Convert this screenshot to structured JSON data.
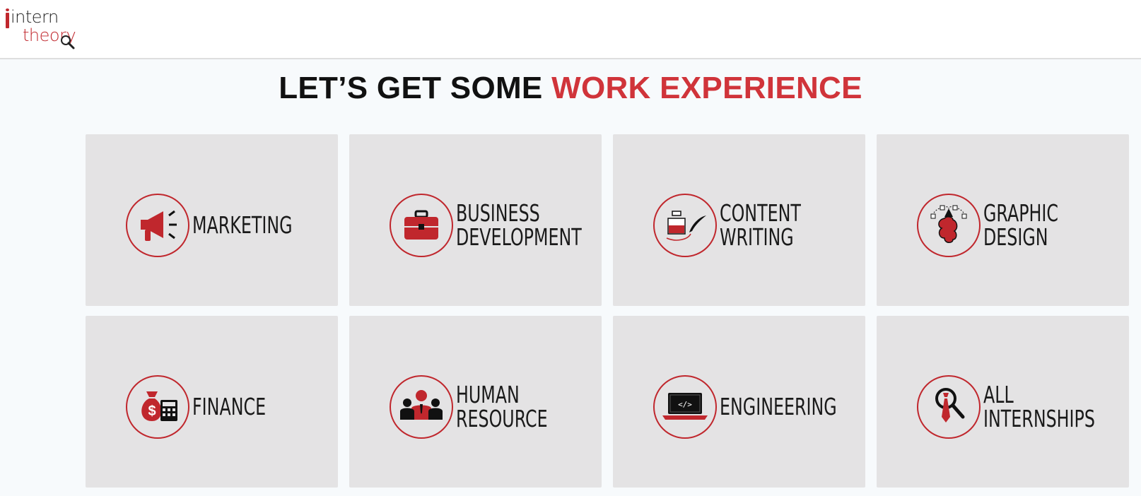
{
  "brand": {
    "line1": "intern",
    "line2": "theory",
    "colors": {
      "red": "#c0272d",
      "dark": "#222222"
    }
  },
  "headline": {
    "black": "LET’S GET SOME",
    "red": "WORK EXPERIENCE"
  },
  "categories": [
    {
      "label_line1": "MARKETING",
      "label_line2": "",
      "icon": "megaphone-icon"
    },
    {
      "label_line1": "BUSINESS",
      "label_line2": "DEVELOPMENT",
      "icon": "briefcase-icon"
    },
    {
      "label_line1": "CONTENT",
      "label_line2": "WRITING",
      "icon": "inkpot-quill-icon"
    },
    {
      "label_line1": "GRAPHIC",
      "label_line2": "DESIGN",
      "icon": "brain-pen-tool-icon"
    },
    {
      "label_line1": "FINANCE",
      "label_line2": "",
      "icon": "moneybag-calculator-icon"
    },
    {
      "label_line1": "HUMAN",
      "label_line2": "RESOURCE",
      "icon": "team-icon"
    },
    {
      "label_line1": "ENGINEERING",
      "label_line2": "",
      "icon": "laptop-code-icon"
    },
    {
      "label_line1": "ALL",
      "label_line2": "INTERNSHIPS",
      "icon": "magnifier-tie-icon"
    }
  ]
}
